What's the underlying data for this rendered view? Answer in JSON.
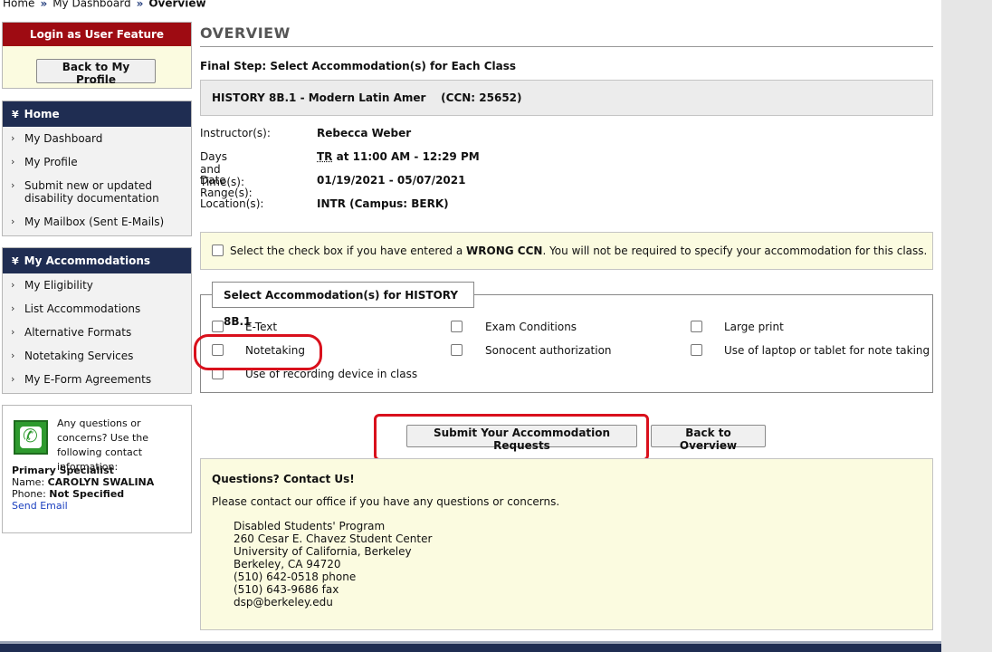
{
  "breadcrumb": {
    "items": [
      "Home",
      "My Dashboard",
      "Overview"
    ],
    "separator": "»"
  },
  "login_feature": {
    "title": "Login as User Feature",
    "button": "Back to My Profile"
  },
  "home_nav": {
    "title": "Home",
    "items": [
      "My Dashboard",
      "My Profile",
      "Submit new or updated disability documentation",
      "My Mailbox (Sent E-Mails)"
    ]
  },
  "accommodations_nav": {
    "title": "My Accommodations",
    "items": [
      "My Eligibility",
      "List Accommodations",
      "Alternative Formats",
      "Notetaking Services",
      "My E-Form Agreements"
    ]
  },
  "contact_box": {
    "intro": "Any questions or concerns? Use the following contact information:",
    "heading": "Primary Specialist",
    "name_label": "Name:",
    "name": "CAROLYN SWALINA",
    "phone_label": "Phone:",
    "phone": "Not Specified",
    "email_link": "Send Email"
  },
  "main": {
    "title": "OVERVIEW",
    "step": "Final Step: Select Accommodation(s) for Each Class",
    "class_header": "HISTORY 8B.1 - Modern Latin Amer    (CCN: 25652)",
    "details": [
      {
        "label": "Instructor(s):",
        "value": "Rebecca Weber"
      },
      {
        "label": "Days and Time(s):",
        "value_days": "TR",
        "value": "at 11:00 AM - 12:29 PM"
      },
      {
        "label": "Date Range(s):",
        "value": "01/19/2021 - 05/07/2021"
      },
      {
        "label": "Location(s):",
        "value": "INTR (Campus: BERK)"
      }
    ],
    "wrong_ccn": {
      "before": "Select the check box if you have entered a",
      "bold": "WRONG CCN",
      "after": ". You will not be required to specify your accommodation for this class.",
      "checked": false
    },
    "accommodations": {
      "legend": "Select Accommodation(s) for HISTORY 8B.1",
      "options": [
        {
          "label": "E-Text",
          "checked": false
        },
        {
          "label": "Exam Conditions",
          "checked": false
        },
        {
          "label": "Large print",
          "checked": false
        },
        {
          "label": "Notetaking",
          "checked": false
        },
        {
          "label": "Sonocent authorization",
          "checked": false
        },
        {
          "label": "Use of laptop or tablet for note taking",
          "checked": false
        },
        {
          "label": "Use of recording device in class",
          "checked": false
        }
      ]
    },
    "buttons": {
      "submit": "Submit Your Accommodation Requests",
      "back": "Back to Overview"
    },
    "contact_us": {
      "title": "Questions? Contact Us!",
      "text": "Please contact our office if you have any questions or concerns.",
      "address_lines": [
        "Disabled Students' Program",
        "260 Cesar E. Chavez Student Center",
        "University of California, Berkeley",
        "Berkeley, CA 94720",
        "(510) 642-0518 phone",
        "(510) 643-9686 fax",
        "dsp@berkeley.edu"
      ]
    }
  },
  "colors": {
    "nav_header": "#1f2d52",
    "login_header": "#9e0b12",
    "highlight_annotation": "#d9101c",
    "info_background": "#fbfbe0"
  }
}
